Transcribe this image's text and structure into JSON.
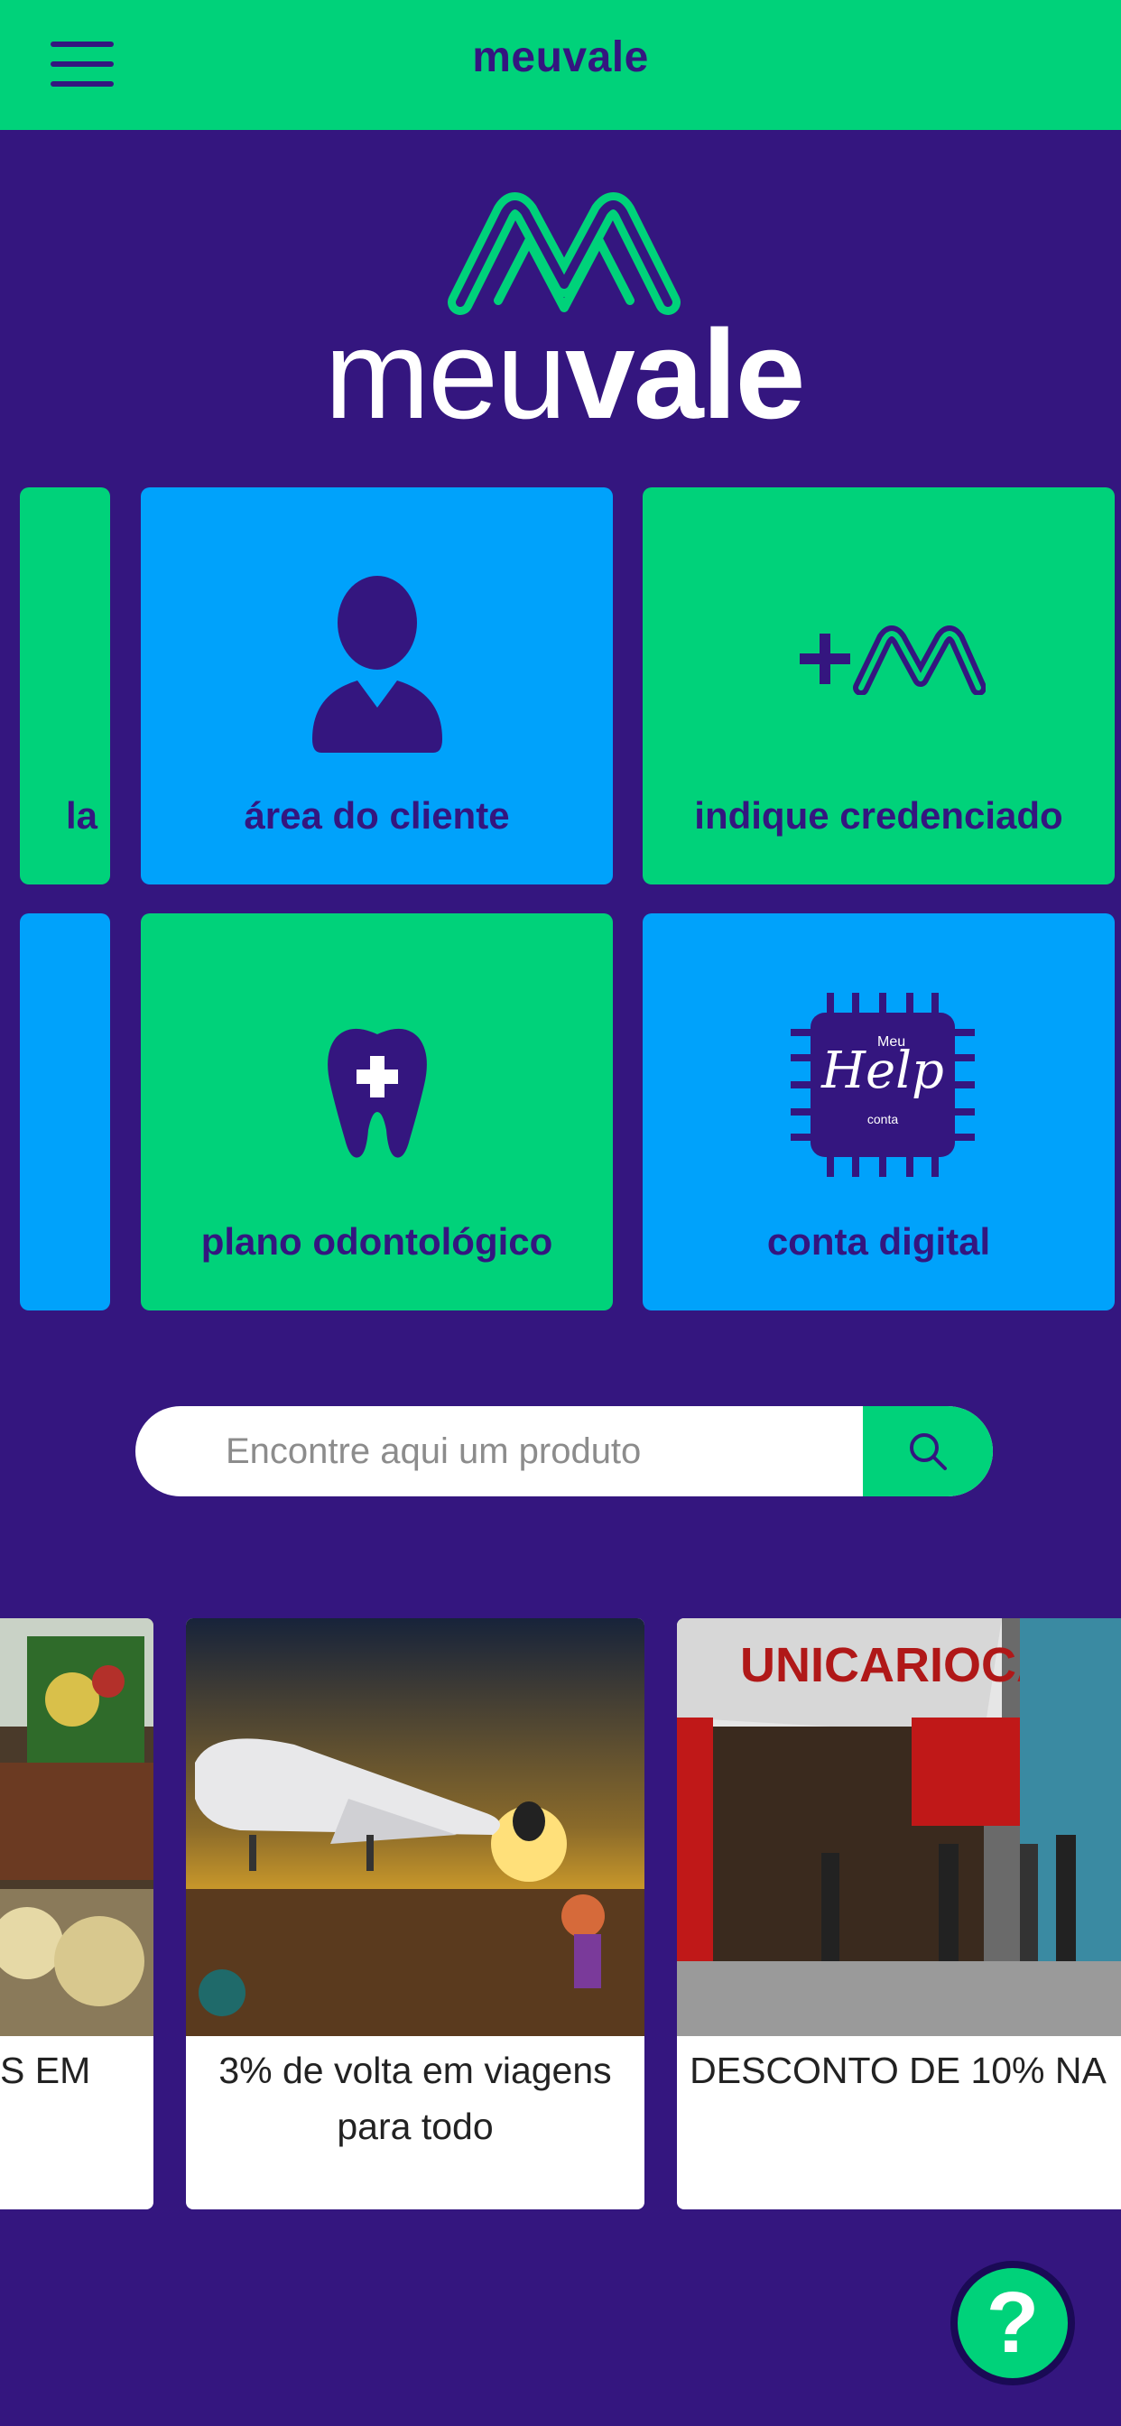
{
  "header": {
    "title": "meuvale",
    "menu_icon": "hamburger-menu-icon"
  },
  "logo": {
    "text_light": "meu",
    "text_bold": "vale"
  },
  "tiles": [
    {
      "label": "la",
      "color": "#00d27a"
    },
    {
      "label": "área do cliente",
      "color": "#00a2fb",
      "icon": "person-icon"
    },
    {
      "label": "indique credenciado",
      "color": "#00d27a",
      "icon": "plus-meuvale-icon"
    },
    {
      "label": "",
      "color": "#00a2fb"
    },
    {
      "label": "plano odontológico",
      "color": "#00d27a",
      "icon": "tooth-icon"
    },
    {
      "label": "conta digital",
      "color": "#00a2fb",
      "icon": "meuhelp-chip-icon"
    }
  ],
  "chip_icon_text": {
    "small": "Meu",
    "main": "Help",
    "sub": "conta"
  },
  "search": {
    "placeholder": "Encontre aqui um produto",
    "icon": "search-icon"
  },
  "cards": [
    {
      "text": "S EM",
      "image": "supermarket-photo"
    },
    {
      "text": "3% de volta em viagens para todo",
      "image": "airplane-sunset-photo"
    },
    {
      "text": "DESCONTO DE 10% NA",
      "image": "unicarioca-storefront-photo"
    }
  ],
  "help": {
    "label": "?"
  },
  "colors": {
    "brand_purple": "#34167f",
    "brand_green": "#00d27a",
    "brand_blue": "#00a2fb"
  }
}
